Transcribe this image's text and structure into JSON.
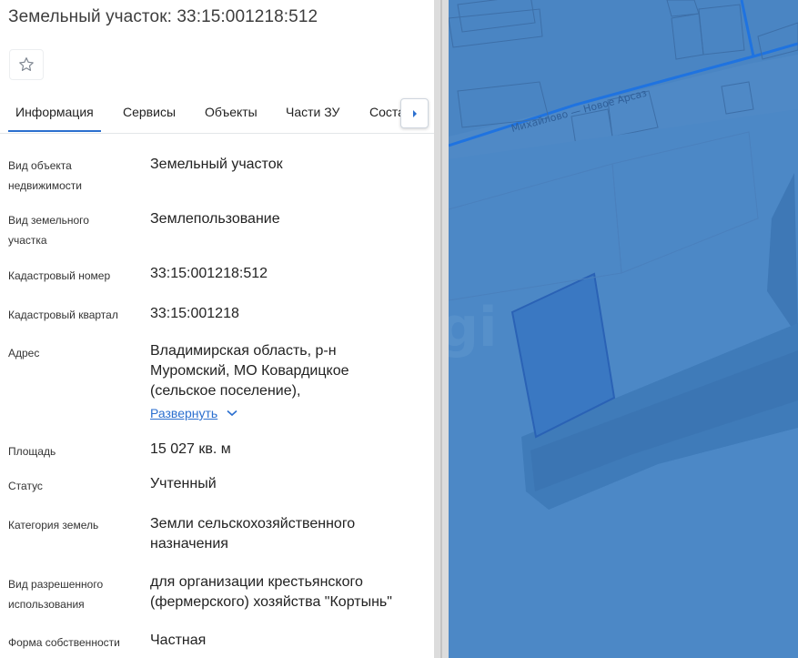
{
  "title": "Земельный участок: 33:15:001218:512",
  "tabs": [
    "Информация",
    "Сервисы",
    "Объекты",
    "Части ЗУ",
    "Соста"
  ],
  "fields": {
    "type_label": [
      "Вид объекта",
      "недвижимости"
    ],
    "type_value": "Земельный участок",
    "plot_kind_label": [
      "Вид земельного",
      "участка"
    ],
    "plot_kind_value": "Землепользование",
    "cad_number_label": "Кадастровый номер",
    "cad_number_value": "33:15:001218:512",
    "cad_quarter_label": "Кадастровый квартал",
    "cad_quarter_value": "33:15:001218",
    "address_label": "Адрес",
    "address_value": [
      "Владимирская область, р-н",
      "Муромский, МО Ковардицкое",
      "(сельское поселение),"
    ],
    "expand_link": "Развернуть",
    "area_label": "Площадь",
    "area_value": "15 027 кв. м",
    "status_label": "Статус",
    "status_value": "Учтенный",
    "land_category_label": "Категория земель",
    "land_category_value": [
      "Земли сельскохозяйственного",
      "назначения"
    ],
    "permitted_use_label": [
      "Вид разрешенного",
      "использования"
    ],
    "permitted_use_value": [
      "для организации крестьянского",
      "(фермерского) хозяйства \"Кортынь\""
    ],
    "ownership_label": "Форма собственности",
    "ownership_value": "Частная"
  },
  "map": {
    "road_label": "Михайлово — Новое Арсаз",
    "watermark": "gi"
  },
  "colors": {
    "accent": "#2b6fcf",
    "map_base": "#4f89c6",
    "map_road": "#1f73e0"
  },
  "icons": {
    "favorite": "star-outline-icon",
    "tabs_scroll": "chevron-right-icon",
    "expand": "chevron-down-icon"
  }
}
